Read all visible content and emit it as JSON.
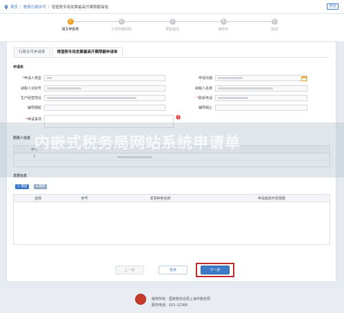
{
  "breadcrumb": {
    "home": "首页",
    "level1": "税务行政许可",
    "current": "增值税专用发票最高开票限额审批"
  },
  "back_label": "返回",
  "steps": [
    {
      "num": "1",
      "label": "填写申报表"
    },
    {
      "num": "2",
      "label": "上传附报资料"
    },
    {
      "num": "3",
      "label": "预览提交"
    },
    {
      "num": "4",
      "label": "审核中"
    },
    {
      "num": "5",
      "label": "完成"
    }
  ],
  "tabs": [
    {
      "label": "行政许可申请表"
    },
    {
      "label": "增值税专用发票最高开票限额申请单"
    }
  ],
  "form": {
    "section_title": "申请表",
    "applicant_type_label": "申请人类型",
    "taxpayer_id_label": "纳税人识别号",
    "address_label": "生产经营地址",
    "agent_start_label": "辅导期起",
    "matter_label": "申请事项",
    "apply_date_label": "申请日期",
    "taxpayer_name_label": "纳税人名称",
    "phone_label": "联系电话",
    "agent_end_label": "辅导期止"
  },
  "buyer": {
    "section_title": "购票人信息",
    "col_seq": "序号",
    "row_seq": "1"
  },
  "invoice": {
    "section_title": "发票信息",
    "add_label": "增加",
    "delete_label": "删除",
    "col_select": "选择",
    "col_seq": "序号",
    "col_type": "发票种类名称",
    "col_limit": "申请最高开票限额"
  },
  "buttons": {
    "prev": "上一步",
    "save": "暂存",
    "next": "下一步"
  },
  "watermark": "内嵌式税务局网站系统申请单",
  "footer": {
    "copyright": "版权所有：国家税务总局上海市税务局",
    "hotline": "服务电话：021-12366"
  },
  "colors": {
    "accent": "#3d7ac7",
    "active_step": "#f0a020",
    "highlight": "#c0282a"
  }
}
